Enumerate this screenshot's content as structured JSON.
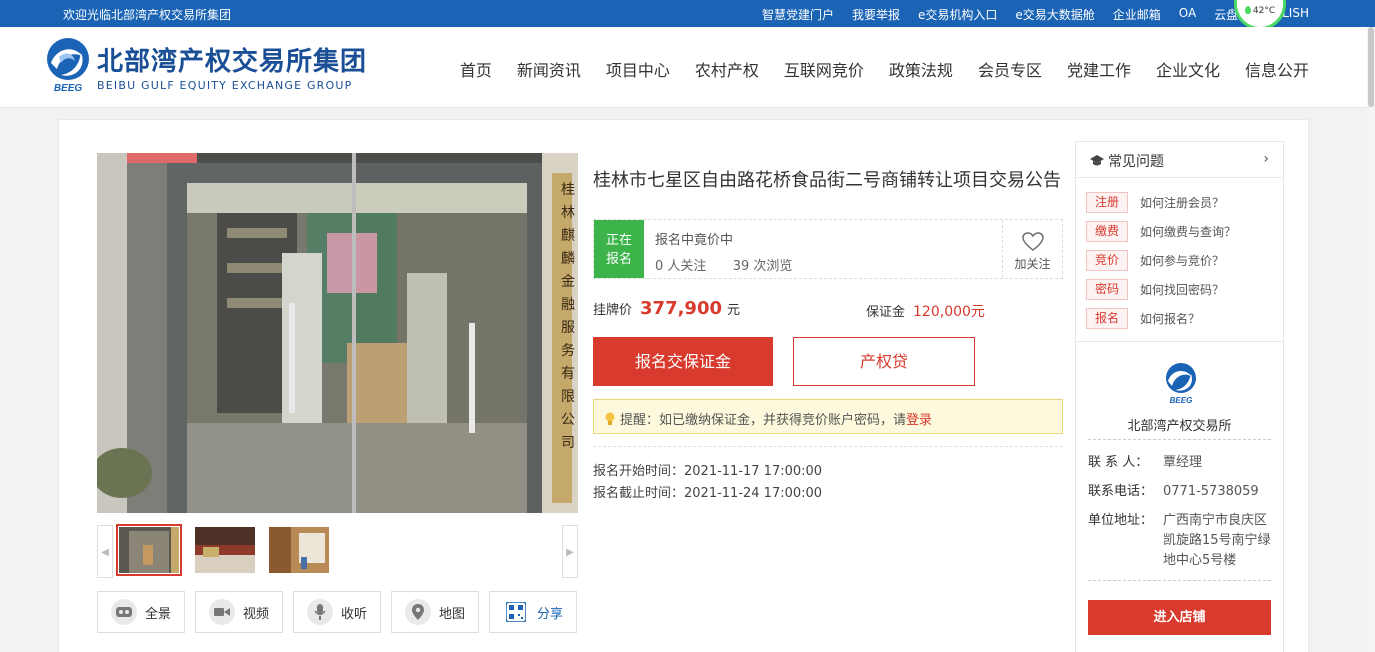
{
  "topbar": {
    "welcome": "欢迎光临北部湾产权交易所集团",
    "links": [
      "智慧党建门户",
      "我要举报",
      "e交易机构入口",
      "e交易大数据舱",
      "企业邮箱",
      "OA",
      "云盘",
      "ENGLISH"
    ],
    "weather": "42°C"
  },
  "header": {
    "logo_abbr": "BEEG",
    "logo_cn": "北部湾产权交易所集团",
    "logo_en": "BEIBU GULF EQUITY EXCHANGE GROUP",
    "nav": [
      "首页",
      "新闻资讯",
      "项目中心",
      "农村产权",
      "互联网竞价",
      "政策法规",
      "会员专区",
      "党建工作",
      "企业文化",
      "信息公开"
    ]
  },
  "project": {
    "title": "桂林市七星区自由路花桥食品街二号商铺转让项目交易公告",
    "status_tag_line1": "正在",
    "status_tag_line2": "报名",
    "status_text": "报名中竟价中",
    "followers": "0 人关注",
    "views": "39 次浏览",
    "fav_label": "加关注",
    "price_label": "挂牌价",
    "price_value": "377,900",
    "price_unit": "元",
    "deposit_label": "保证金",
    "deposit_value": "120,000元",
    "signup_button": "报名交保证金",
    "loan_button": "产权贷",
    "notice_text": "提醒：如已缴纳保证金，并获得竞价账户密码，请",
    "notice_link": "登录",
    "start_time": "报名开始时间：2021-11-17 17:00:00",
    "end_time": "报名截止时间：2021-11-24 17:00:00"
  },
  "photo": {
    "sign_text": "桂林麒麟金融服务有限公司"
  },
  "tools": [
    "全景",
    "视频",
    "收听",
    "地图",
    "分享"
  ],
  "faq": {
    "title": "常见问题",
    "items": [
      {
        "tag": "注册",
        "text": "如何注册会员？"
      },
      {
        "tag": "缴费",
        "text": "如何缴费与查询？"
      },
      {
        "tag": "竞价",
        "text": "如何参与竞价？"
      },
      {
        "tag": "密码",
        "text": "如何找回密码？"
      },
      {
        "tag": "报名",
        "text": "如何报名？"
      }
    ]
  },
  "shop": {
    "logo_abbr": "BEEG",
    "name": "北部湾产权交易所",
    "contact_label": "联 系 人：",
    "contact_value": "覃经理",
    "phone_label": "联系电话：",
    "phone_value": "0771-5738059",
    "address_label": "单位地址：",
    "address_value": "广西南宁市良庆区凯旋路15号南宁绿地中心5号楼",
    "enter_button": "进入店铺"
  }
}
